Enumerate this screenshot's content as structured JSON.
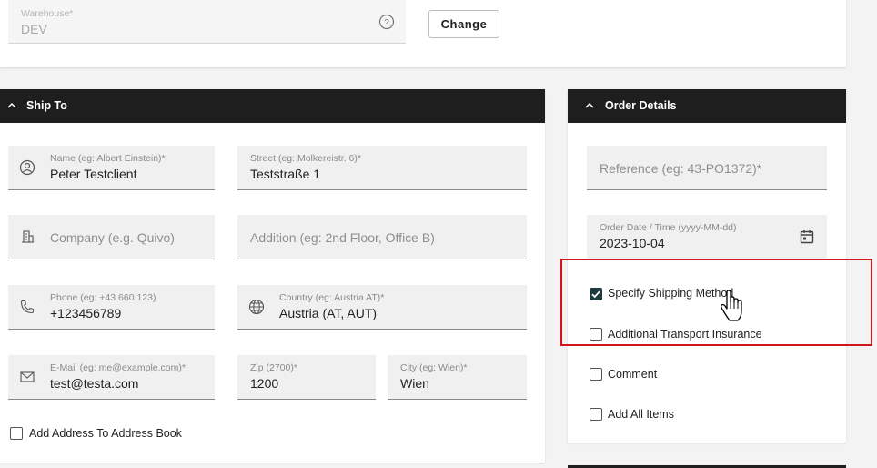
{
  "warehouse": {
    "label": "Warehouse*",
    "value": "DEV",
    "change_button": "Change"
  },
  "ship_to": {
    "title": "Ship To",
    "name": {
      "label": "Name (eg: Albert Einstein)*",
      "value": "Peter Testclient"
    },
    "street": {
      "label": "Street (eg: Molkereistr. 6)*",
      "value": "Teststraße 1"
    },
    "company": {
      "placeholder": "Company (e.g. Quivo)"
    },
    "addition": {
      "placeholder": "Addition (eg: 2nd Floor, Office B)"
    },
    "phone": {
      "label": "Phone (eg: +43 660 123)",
      "value": "+123456789"
    },
    "country": {
      "label": "Country (eg: Austria AT)*",
      "value": "Austria (AT, AUT)"
    },
    "email": {
      "label": "E-Mail (eg: me@example.com)*",
      "value": "test@testa.com"
    },
    "zip": {
      "label": "Zip (2700)*",
      "value": "1200"
    },
    "city": {
      "label": "City (eg: Wien)*",
      "value": "Wien"
    },
    "add_to_address_book": {
      "label": "Add Address To Address Book",
      "checked": false
    }
  },
  "order_details": {
    "title": "Order Details",
    "reference": {
      "placeholder": "Reference (eg: 43-PO1372)*"
    },
    "order_date": {
      "label": "Order Date / Time (yyyy-MM-dd)",
      "value": "2023-10-04"
    },
    "options": [
      {
        "label": "Specify Shipping Method",
        "checked": true
      },
      {
        "label": "Additional Transport Insurance",
        "checked": false
      },
      {
        "label": "Comment",
        "checked": false
      },
      {
        "label": "Add All Items",
        "checked": false
      }
    ]
  },
  "colors": {
    "header_bg": "#1e1e1e",
    "checkbox_checked": "#1f3b3f",
    "highlight_border": "#d0161e"
  }
}
